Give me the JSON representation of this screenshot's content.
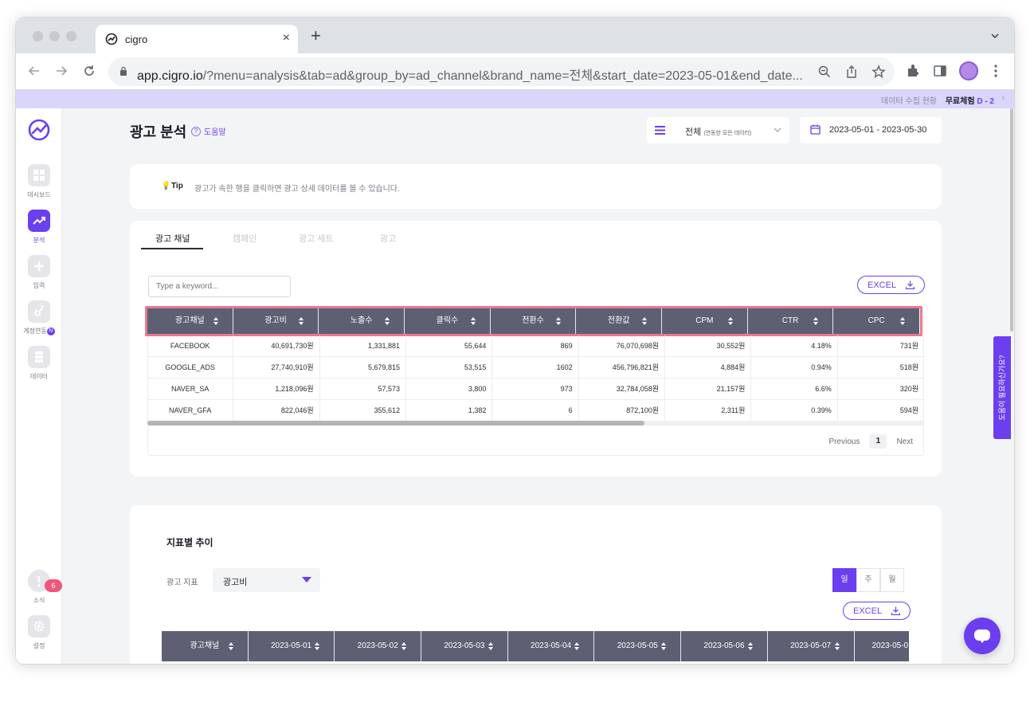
{
  "browser": {
    "tab_title": "cigro",
    "url_host": "app.cigro.io",
    "url_rest": "/?menu=analysis&tab=ad&group_by=ad_channel&brand_name=전체&start_date=2023-05-01&end_date..."
  },
  "banner": {
    "status_link": "데이터 수집 현황",
    "trial_label": "무료체험",
    "trial_days": "D - 2"
  },
  "sidebar": {
    "items": [
      {
        "label": "대시보드",
        "icon": "dashboard-icon"
      },
      {
        "label": "분석",
        "icon": "analysis-icon",
        "active": true
      },
      {
        "label": "입력",
        "icon": "plus-icon"
      },
      {
        "label": "계정연동",
        "icon": "link-icon",
        "badge": "N"
      },
      {
        "label": "데이터",
        "icon": "database-icon"
      },
      {
        "label": "소식",
        "icon": "notice-icon",
        "badge": "6"
      },
      {
        "label": "설정",
        "icon": "gear-icon"
      }
    ]
  },
  "header": {
    "title": "광고 분석",
    "help": "도움말",
    "brand_value": "전체",
    "brand_note": "(연동한 모든 데이터)",
    "date_range": "2023-05-01 - 2023-05-30"
  },
  "tip": {
    "key": "Tip",
    "text": "광고가 속한 행을 클릭하면 광고 상세 데이터를 볼 수 있습니다."
  },
  "tabs": [
    "광고 채널",
    "캠페인",
    "광고 세트",
    "광고"
  ],
  "search": {
    "placeholder": "Type a keyword..."
  },
  "excel_label": "EXCEL",
  "table": {
    "columns": [
      "광고채널",
      "광고비",
      "노출수",
      "클릭수",
      "전환수",
      "전환값",
      "CPM",
      "CTR",
      "CPC"
    ],
    "rows": [
      [
        "FACEBOOK",
        "40,691,730원",
        "1,331,881",
        "55,644",
        "869",
        "76,070,698원",
        "30,552원",
        "4.18%",
        "731원"
      ],
      [
        "GOOGLE_ADS",
        "27,740,910원",
        "5,679,815",
        "53,515",
        "1602",
        "456,796,821원",
        "4,884원",
        "0.94%",
        "518원"
      ],
      [
        "NAVER_SA",
        "1,218,096원",
        "57,573",
        "3,800",
        "973",
        "32,784,058원",
        "21,157원",
        "6.6%",
        "320원"
      ],
      [
        "NAVER_GFA",
        "822,046원",
        "355,612",
        "1,382",
        "6",
        "872,100원",
        "2,311원",
        "0.39%",
        "594원"
      ]
    ]
  },
  "pager": {
    "previous": "Previous",
    "page": "1",
    "next": "Next"
  },
  "trend": {
    "title": "지표별 추이",
    "metric_label": "광고 지표",
    "metric_value": "광고비",
    "periods": [
      "일",
      "주",
      "월"
    ],
    "columns": [
      "광고채널",
      "2023-05-01",
      "2023-05-02",
      "2023-05-03",
      "2023-05-04",
      "2023-05-05",
      "2023-05-06",
      "2023-05-07",
      "2023-05-0"
    ]
  },
  "help_tab": "도움이 필요하신가요?",
  "colors": {
    "accent": "#6b3ff0",
    "header_bg": "#5d6072",
    "highlight": "#e8798f",
    "banner": "#d9d5fb"
  }
}
